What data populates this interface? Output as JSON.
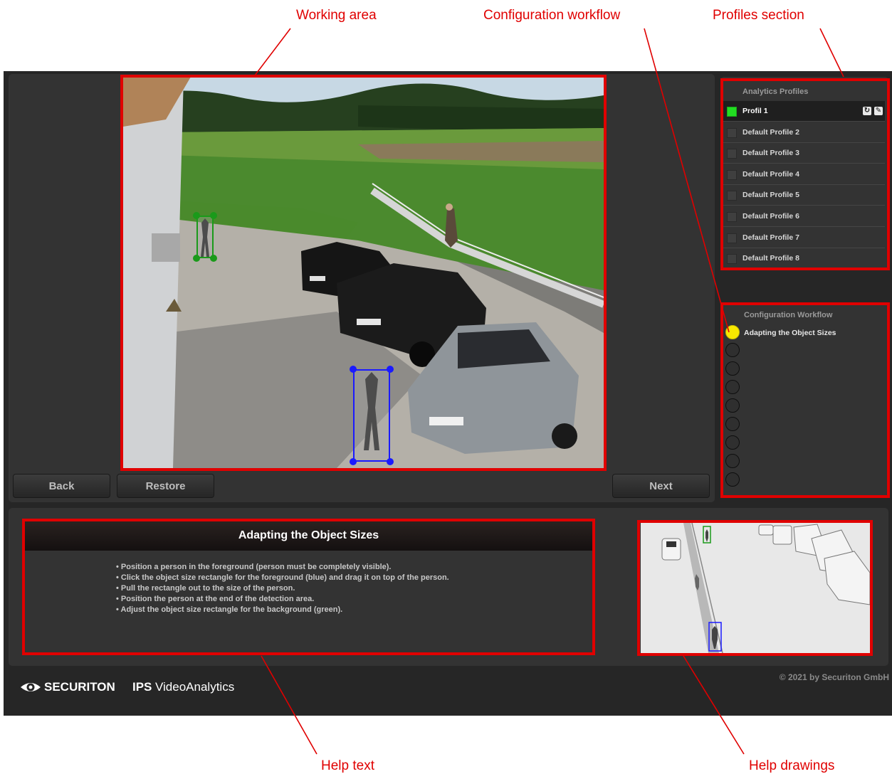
{
  "annotations": {
    "working_area": "Working area",
    "configuration_workflow": "Configuration workflow",
    "profiles_section": "Profiles section",
    "help_text": "Help text",
    "help_drawings": "Help drawings"
  },
  "buttons": {
    "back": "Back",
    "restore": "Restore",
    "next": "Next"
  },
  "profiles": {
    "title": "Analytics Profiles",
    "items": [
      {
        "label": "Profil 1",
        "active": true
      },
      {
        "label": "Default Profile 2",
        "active": false
      },
      {
        "label": "Default Profile 3",
        "active": false
      },
      {
        "label": "Default Profile 4",
        "active": false
      },
      {
        "label": "Default Profile 5",
        "active": false
      },
      {
        "label": "Default Profile 6",
        "active": false
      },
      {
        "label": "Default Profile 7",
        "active": false
      },
      {
        "label": "Default Profile 8",
        "active": false
      }
    ]
  },
  "workflow": {
    "title": "Configuration Workflow",
    "current_step": "Adapting the Object Sizes"
  },
  "help": {
    "title": "Adapting the Object Sizes",
    "items": [
      "Position a person in the foreground (person must be completely visible).",
      "Click the object size rectangle for the foreground (blue) and drag it on top of the person.",
      "Pull the rectangle out to the size of the person.",
      "Position the person at the end of the detection area.",
      "Adjust the object size rectangle for the background (green)."
    ]
  },
  "footer": {
    "brand_securiton": "SECURITON",
    "brand_ips": "IPS",
    "brand_product": "VideoAnalytics",
    "copyright": "© 2021 by Securiton GmbH"
  },
  "colors": {
    "annotation_red": "#e00000",
    "active_profile": "#22dd22",
    "workflow_current": "#f8e800",
    "foreground_box": "#1a1aff",
    "background_box": "#1a9a1a"
  },
  "icons": {
    "profile_refresh": "refresh-icon",
    "profile_edit": "edit-icon",
    "logo_eye": "eye-logo-icon"
  }
}
